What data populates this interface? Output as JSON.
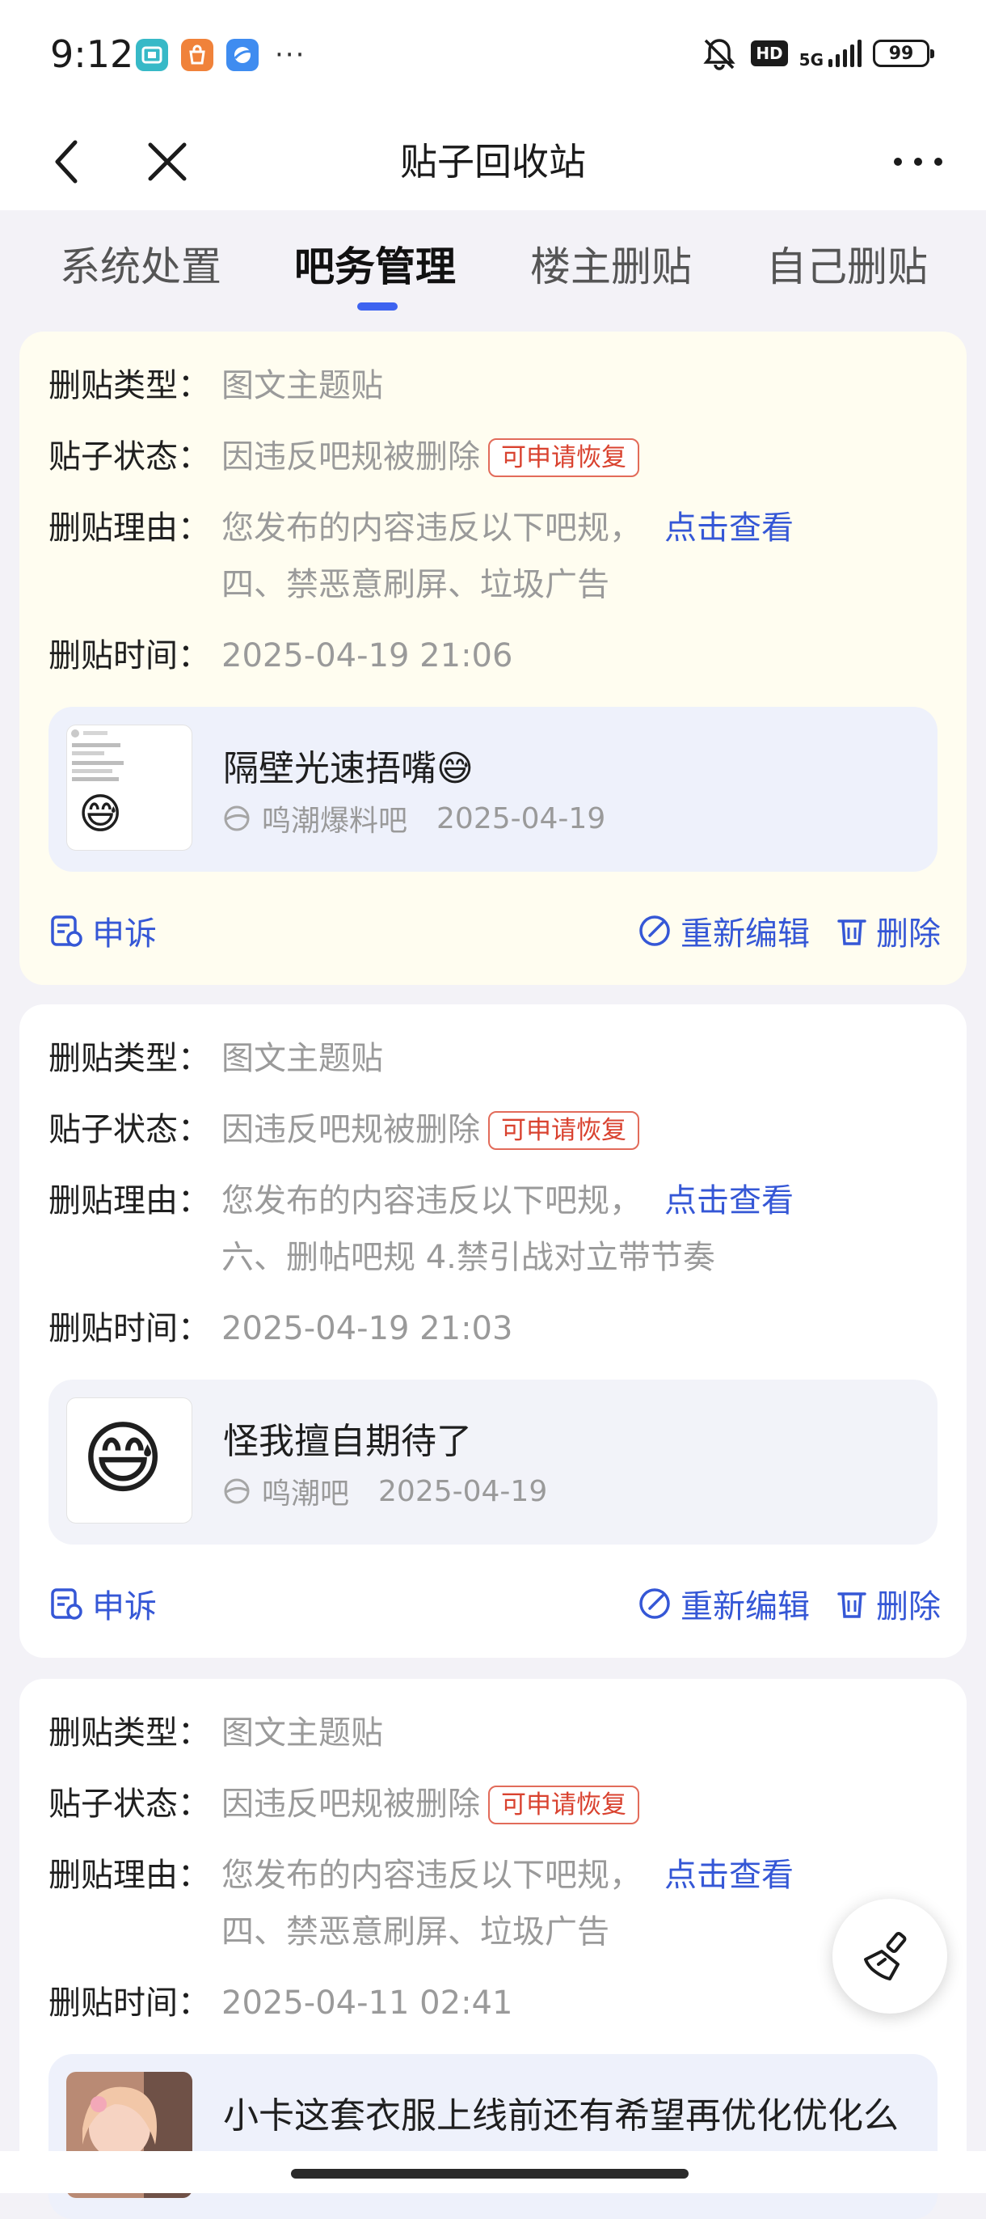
{
  "status_bar": {
    "time": "9:12",
    "apps": [
      {
        "icon": "app-icon-teal",
        "color": "#37b9c7"
      },
      {
        "icon": "app-icon-orange",
        "color": "#f0823a"
      },
      {
        "icon": "app-icon-blue",
        "color": "#3f8cf0"
      }
    ],
    "more": "···",
    "hd": "HD",
    "network": "5G",
    "battery": "99"
  },
  "nav": {
    "title": "贴子回收站"
  },
  "tabs": [
    {
      "label": "系统处置",
      "active": false
    },
    {
      "label": "吧务管理",
      "active": true
    },
    {
      "label": "楼主删贴",
      "active": false
    },
    {
      "label": "自己删贴",
      "active": false
    }
  ],
  "colors": {
    "accent": "#3d63f0",
    "link": "#3557d6",
    "badge_red": "#d9422f",
    "highlight_card": "#fffdf0"
  },
  "labels": {
    "type": "删贴类型：",
    "status": "贴子状态：",
    "reason": "删贴理由：",
    "time": "删贴时间：",
    "view_link": "点击查看",
    "appeal": "申诉",
    "reedit": "重新编辑",
    "delete": "删除"
  },
  "cards": [
    {
      "type": "图文主题贴",
      "status": "因违反吧规被删除",
      "badge": "可申请恢复",
      "reason_line1": "您发布的内容违反以下吧规，",
      "reason_line2": "四、禁恶意刷屏、垃圾广告",
      "time": "2025-04-19 21:06",
      "post": {
        "title": "隔壁光速捂嘴😅",
        "forum": "鸣潮爆料吧",
        "date": "2025-04-19",
        "thumb_emoji": "😅"
      }
    },
    {
      "type": "图文主题贴",
      "status": "因违反吧规被删除",
      "badge": "可申请恢复",
      "reason_line1": "您发布的内容违反以下吧规，",
      "reason_line2": "六、删帖吧规 4.禁引战对立带节奏",
      "time": "2025-04-19 21:03",
      "post": {
        "title": "怪我擅自期待了",
        "forum": "鸣潮吧",
        "date": "2025-04-19",
        "thumb_emoji": "😅"
      }
    },
    {
      "type": "图文主题贴",
      "status": "因违反吧规被删除",
      "badge": "可申请恢复",
      "reason_line1": "您发布的内容违反以下吧规，",
      "reason_line2": "四、禁恶意刷屏、垃圾广告",
      "time": "2025-04-11 02:41",
      "post": {
        "title": "小卡这套衣服上线前还有希望再优化优化么"
      }
    }
  ]
}
